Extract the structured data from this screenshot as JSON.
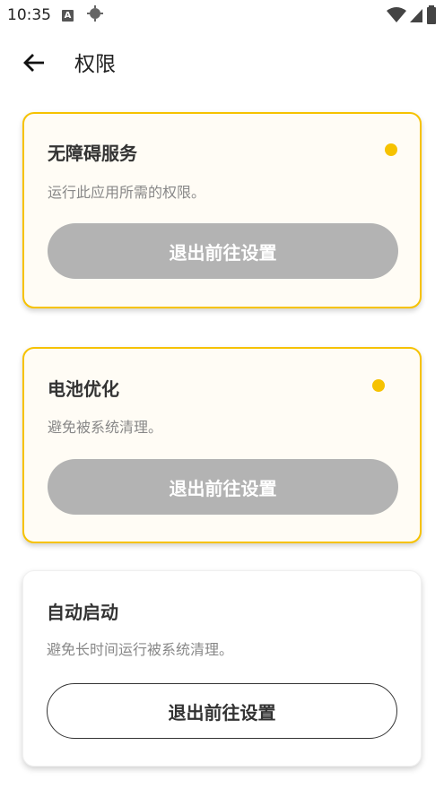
{
  "status_bar": {
    "time": "10:35",
    "icons": [
      "a-icon",
      "location-crosshair-icon",
      "wifi-icon",
      "signal-icon",
      "battery-icon"
    ]
  },
  "header": {
    "back_icon": "arrow-left-icon",
    "title": "权限"
  },
  "colors": {
    "accent": "#f6c200",
    "pending_card_bg": "#fffcf5",
    "disabled_button": "#b3b3b3",
    "text_primary": "#333333",
    "text_secondary": "#888888"
  },
  "permissions": [
    {
      "title": "无障碍服务",
      "description": "运行此应用所需的权限。",
      "button_label": "退出前往设置",
      "state": "pending"
    },
    {
      "title": "电池优化",
      "description": "避免被系统清理。",
      "button_label": "退出前往设置",
      "state": "pending"
    },
    {
      "title": "自动启动",
      "description": "避免长时间运行被系统清理。",
      "button_label": "退出前往设置",
      "state": "normal"
    }
  ]
}
